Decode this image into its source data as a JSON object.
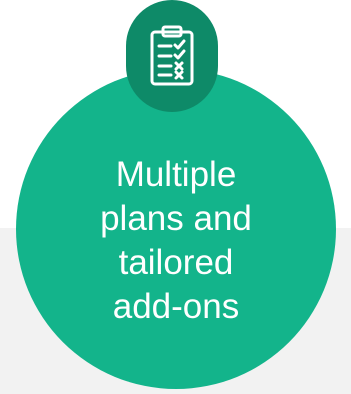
{
  "colors": {
    "circle_fill": "#13b48b",
    "icon_circle_fill": "#0e8a68",
    "text": "#ffffff",
    "icon": "#ffffff",
    "background_band": "#f2f2f2"
  },
  "card": {
    "icon": "clipboard-checklist-icon",
    "title": "Multiple\nplans and\ntailored\nadd-ons"
  }
}
